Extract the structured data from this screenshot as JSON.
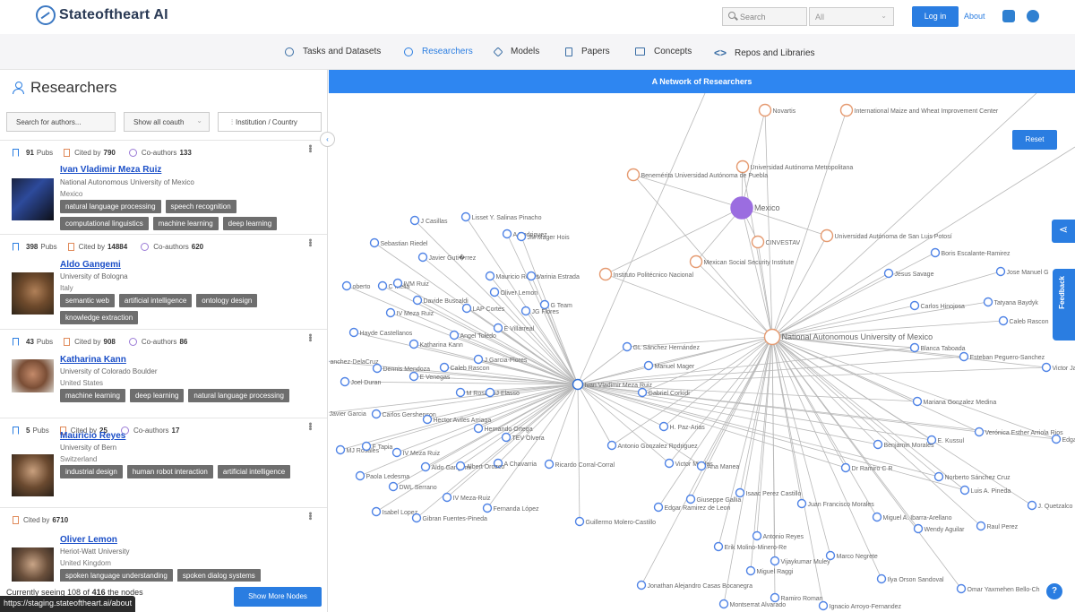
{
  "header": {
    "app_name": "Stateoftheart AI",
    "search_placeholder": "Search",
    "scope_value": "All",
    "login_label": "Log in",
    "about_label": "About"
  },
  "nav": {
    "items": [
      {
        "label": "Tasks and Datasets",
        "icon": "circle-icon"
      },
      {
        "label": "Researchers",
        "icon": "person-icon",
        "active": true
      },
      {
        "label": "Models",
        "icon": "layers-icon"
      },
      {
        "label": "Papers",
        "icon": "document-icon"
      },
      {
        "label": "Concepts",
        "icon": "book-icon"
      },
      {
        "label": "Repos and Libraries",
        "icon": "code-icon"
      }
    ]
  },
  "sidebar": {
    "title": "Researchers",
    "author_search_placeholder": "Search for authors...",
    "coauthor_filter": "Show all coauth",
    "institution_filter": "Institution / Country",
    "researchers": [
      {
        "pubs": "91",
        "pubs_label": "Pubs",
        "cited_label": "Cited by",
        "cited": "790",
        "coauthors_label": "Co-authors",
        "coauthors": "133",
        "name": "Ivan Vladimir Meza Ruiz",
        "affiliation": "National Autonomous University of Mexico",
        "country": "Mexico",
        "tags": [
          "natural language processing",
          "speech recognition",
          "computational linguistics",
          "machine learning",
          "deep learning"
        ]
      },
      {
        "pubs": "398",
        "pubs_label": "Pubs",
        "cited_label": "Cited by",
        "cited": "14884",
        "coauthors_label": "Co-authors",
        "coauthors": "620",
        "name": "Aldo Gangemi",
        "affiliation": "University of Bologna",
        "country": "Italy",
        "tags": [
          "semantic web",
          "artificial intelligence",
          "ontology design",
          "knowledge extraction"
        ]
      },
      {
        "pubs": "43",
        "pubs_label": "Pubs",
        "cited_label": "Cited by",
        "cited": "908",
        "coauthors_label": "Co-authors",
        "coauthors": "86",
        "name": "Katharina Kann",
        "affiliation": "University of Colorado Boulder",
        "country": "United States",
        "tags": [
          "machine learning",
          "deep learning",
          "natural language processing"
        ]
      },
      {
        "pubs": "5",
        "pubs_label": "Pubs",
        "cited_label": "Cited by",
        "cited": "25",
        "coauthors_label": "Co-authors",
        "coauthors": "17",
        "name": "Mauricio Reyes",
        "affiliation": "University of Bern",
        "country": "Switzerland",
        "tags": [
          "industrial design",
          "human robot interaction",
          "artificial intelligence"
        ]
      },
      {
        "cited_label": "Cited by",
        "cited": "6710",
        "name": "Oliver Lemon",
        "affiliation": "Heriot-Watt University",
        "country": "United Kingdom",
        "tags": [
          "spoken language understanding",
          "spoken dialog systems"
        ]
      }
    ],
    "footer": {
      "seeing_prefix": "Currently seeing 108 of",
      "seeing_total": "416",
      "seeing_suffix": "the nodes",
      "show_more_label": "Show More Nodes"
    }
  },
  "status_url": "https://staging.stateoftheart.ai/about",
  "network": {
    "title": "A Network of Researchers",
    "reset_label": "Reset",
    "feedback_label": "Feedback",
    "center_researcher": "Ivan Vladimir Meza Ruiz",
    "center_institution": "National Autonomous University of Mexico",
    "country_node": "Mexico",
    "institutions": [
      "Novartis",
      "International Maize and Wheat Improvement Center",
      "Universidad Autónoma Metropolitana",
      "Benemérita Universidad Autónoma de Puebla",
      "CINVESTAV",
      "Universidad Autónoma de San Luis Potosí",
      "Instituto Politécnico Nacional",
      "Mexican Social Security Institute"
    ],
    "left_nodes": [
      "J Casillas",
      "Lisset Y. Salinas Pinacho",
      "A Rodriguez",
      "JM Mager Hois",
      "Sebastian Riedel",
      "Javier Guti�rrez",
      "Mauricio Reyes",
      "Varinia Estrada",
      "oberto",
      "C Mella",
      "IVM Ruiz",
      "Oliver Lemon",
      "Davide Buscaldi",
      "LAP Cortes",
      "G Team",
      "IV Meza Ruiz",
      "JG Flores",
      "Angel Toledo",
      "E Villarreal",
      "Hayde Castellanos",
      "Katharina Kann",
      "J Garcia-Flores",
      "anchez-DelaCruz",
      "Dennis Mendoza",
      "Caleb Rascon",
      "Joel Duran",
      "E Venegas",
      "M Rosales",
      "J Elasso",
      "Javier Garcia",
      "Carlos Gershenson",
      "Hector Aviles Arriaga",
      "Hernando Ortega",
      "TEV Olvera",
      "MJ Rosales",
      "F Tapia",
      "IV Meza Ruiz",
      "A Chavarria",
      "Ricardo Corral-Corral",
      "Paola Ledesma",
      "Aldo Gangemi",
      "Albert Orozco",
      "DWL Serrano",
      "IV Meza-Ruiz",
      "Isabel Lopez",
      "Gibran Fuentes-Pineda",
      "Fernanda López",
      "Guillermo Molero-Castillo"
    ],
    "right_nodes": [
      "Boris Escalante-Ramirez",
      "Jose Manuel G",
      "Jesus Savage",
      "Carlos Hinojosa",
      "Tatyana Baydyk",
      "Caleb Rascon",
      "GL Sánchez Hernández",
      "Blanca Taboada",
      "Esteban Peguero-Sanchez",
      "Victor Ja",
      "Manuel Mager",
      "Gabriel Corkidi",
      "Mariana Gonzalez Medina",
      "H. Paz-Arias",
      "Verónica Esther Arriola Rios",
      "Edgar",
      "E. Kussul",
      "Benjamin Morales",
      "Antonio Gonzalez Rodriguez",
      "Victor Mireles",
      "Ana Manea",
      "Dr Ramiro C R",
      "Norberto Sánchez Cruz",
      "Luis A. Pineda",
      "Isaac Perez Castillo",
      "Edgar Ramirez de Leon",
      "Giuseppe Gallia",
      "Juan Francisco Morales",
      "J. Quetzalco",
      "Miguel A. Ibarra-Arellano",
      "Raul Perez",
      "Wendy Aguilar",
      "Antonio Reyes",
      "Erik Molino-Minero-Re",
      "Marco Negrete",
      "Vijaykumar Muley",
      "Miguel Raggi",
      "Ilya Orson Sandoval",
      "Jonathan Alejandro Casas Bocanegra",
      "Omar Yaxmehen Bello-Ch",
      "Ramiro Roman",
      "Montserrat Alvarado",
      "Ignacio Arroyo-Fernandez"
    ]
  }
}
